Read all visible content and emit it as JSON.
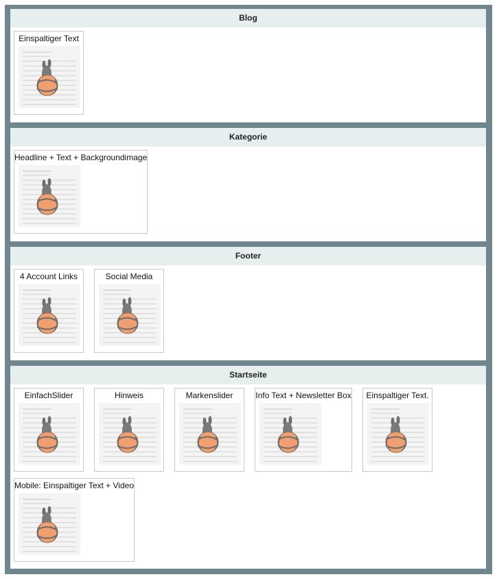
{
  "sections": [
    {
      "title": "Blog",
      "items": [
        {
          "label": "Einspaltiger Text",
          "icon": "module-thumbnail-icon"
        }
      ]
    },
    {
      "title": "Kategorie",
      "items": [
        {
          "label": "Headline + Text + Backgroundimage",
          "icon": "module-thumbnail-icon"
        }
      ]
    },
    {
      "title": "Footer",
      "items": [
        {
          "label": "4 Account Links",
          "icon": "module-thumbnail-icon"
        },
        {
          "label": "Social Media",
          "icon": "module-thumbnail-icon"
        }
      ]
    },
    {
      "title": "Startseite",
      "items": [
        {
          "label": "EinfachSlider",
          "icon": "module-thumbnail-icon"
        },
        {
          "label": "Hinweis",
          "icon": "module-thumbnail-icon"
        },
        {
          "label": "Markenslider",
          "icon": "module-thumbnail-icon"
        },
        {
          "label": "Info Text + Newsletter Box",
          "icon": "module-thumbnail-icon"
        },
        {
          "label": "Einspaltiger Text.",
          "icon": "module-thumbnail-icon"
        },
        {
          "label": "Mobile: Einspaltiger Text + Video",
          "icon": "module-thumbnail-icon"
        }
      ]
    }
  ],
  "colors": {
    "frame": "#6f868e",
    "header_bg": "#e6eeee",
    "tile_border": "#c8c8c8",
    "ball": "#f0a070"
  }
}
